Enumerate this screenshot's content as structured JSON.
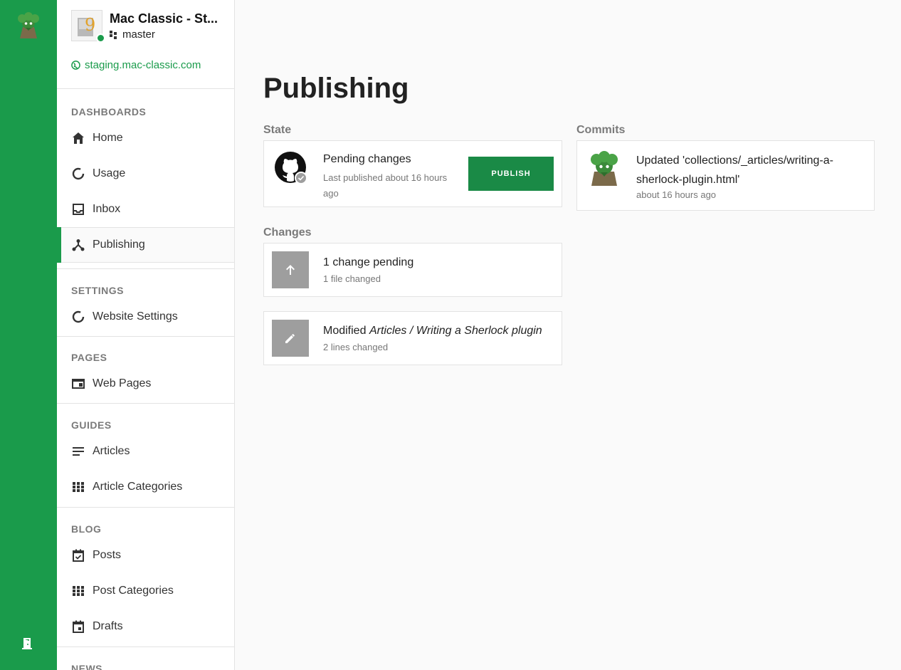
{
  "site": {
    "name": "Mac Classic - St...",
    "branch": "master",
    "url": "staging.mac-classic.com"
  },
  "sidebar": {
    "sections": [
      {
        "title": "DASHBOARDS",
        "items": [
          {
            "label": "Home",
            "icon": "home-icon"
          },
          {
            "label": "Usage",
            "icon": "usage-icon"
          },
          {
            "label": "Inbox",
            "icon": "inbox-icon"
          },
          {
            "label": "Publishing",
            "icon": "publishing-icon",
            "active": true
          }
        ]
      },
      {
        "title": "SETTINGS",
        "items": [
          {
            "label": "Website Settings",
            "icon": "settings-icon"
          }
        ]
      },
      {
        "title": "PAGES",
        "items": [
          {
            "label": "Web Pages",
            "icon": "web-page-icon"
          }
        ]
      },
      {
        "title": "GUIDES",
        "items": [
          {
            "label": "Articles",
            "icon": "articles-icon"
          },
          {
            "label": "Article Categories",
            "icon": "grid-icon"
          }
        ]
      },
      {
        "title": "BLOG",
        "items": [
          {
            "label": "Posts",
            "icon": "calendar-check-icon"
          },
          {
            "label": "Post Categories",
            "icon": "grid-icon"
          },
          {
            "label": "Drafts",
            "icon": "calendar-icon"
          }
        ]
      },
      {
        "title": "NEWS",
        "items": []
      }
    ]
  },
  "main": {
    "title": "Publishing",
    "state": {
      "label": "State",
      "status": "Pending changes",
      "last_published": "Last published about 16 hours ago",
      "button": "PUBLISH"
    },
    "commits": {
      "label": "Commits",
      "items": [
        {
          "message": "Updated 'collections/_articles/writing-a-sherlock-plugin.html'",
          "time": "about 16 hours ago"
        }
      ]
    },
    "changes": {
      "label": "Changes",
      "summary": {
        "title": "1 change pending",
        "sub": "1 file changed"
      },
      "items": [
        {
          "action": "Modified",
          "target": "Articles / Writing a Sherlock plugin",
          "sub": "2 lines changed"
        }
      ]
    }
  },
  "colors": {
    "brand": "#1a9b4b",
    "button": "#1a8a46"
  }
}
